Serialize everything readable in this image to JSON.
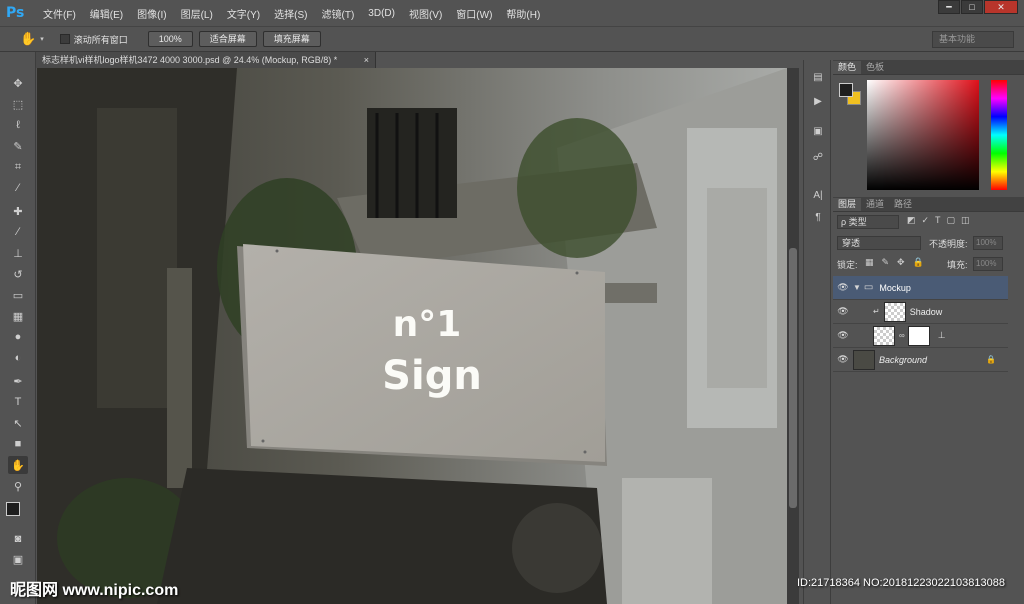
{
  "app": {
    "logo": "Ps"
  },
  "menu": [
    "文件(F)",
    "编辑(E)",
    "图像(I)",
    "图层(L)",
    "文字(Y)",
    "选择(S)",
    "滤镜(T)",
    "3D(D)",
    "视图(V)",
    "窗口(W)",
    "帮助(H)"
  ],
  "window_controls": {
    "minimize": "━",
    "maximize": "□",
    "close": "✕"
  },
  "options": {
    "scroll_all_label": "滚动所有窗口",
    "zoom_100": "100%",
    "fit_screen": "适合屏幕",
    "fill_screen": "填充屏幕",
    "workspace": "基本功能"
  },
  "document": {
    "tab_title": "标志样机vi样机logo样机3472 4000 3000.psd @ 24.4% (Mockup, RGB/8) *",
    "tab_close": "×"
  },
  "sign": {
    "line1": "n°1",
    "line2": "Sign"
  },
  "color_panel": {
    "tab_color": "颜色",
    "tab_swatches": "色板",
    "fg_color": "#1e1e1e",
    "bg_color": "#f0c020"
  },
  "layers_panel": {
    "tab_layers": "图层",
    "tab_channels": "通道",
    "tab_paths": "路径",
    "filter_label": "ρ 类型",
    "blend_mode": "穿透",
    "opacity_label": "不透明度:",
    "opacity_value": "100%",
    "lock_label": "锁定:",
    "fill_label": "填充:",
    "fill_value": "100%",
    "layers": [
      {
        "name": "Mockup",
        "type": "group"
      },
      {
        "name": "Shadow",
        "type": "layer"
      },
      {
        "name": "",
        "type": "smart"
      },
      {
        "name": "Background",
        "type": "background"
      }
    ]
  },
  "watermark": {
    "site": "昵图网 www.nipic.com",
    "id": "ID:21718364 NO:20181223022103813088"
  }
}
